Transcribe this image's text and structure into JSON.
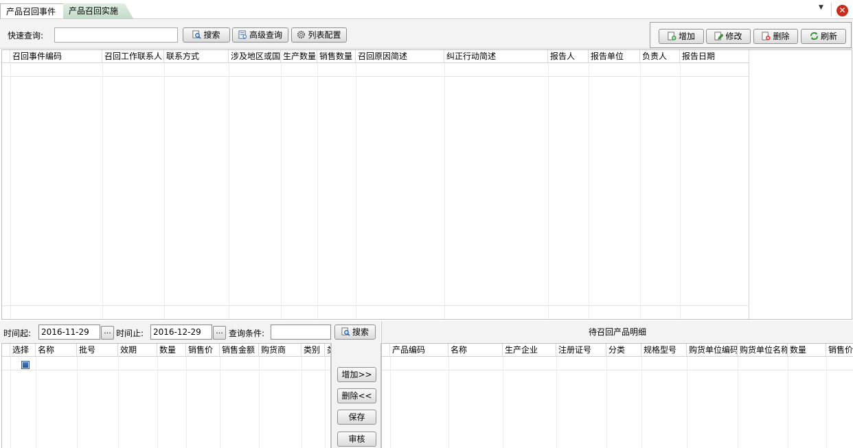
{
  "tabs": {
    "recall_event": "产品召回事件",
    "recall_impl": "产品召回实施"
  },
  "icons": {
    "dropdown": "▼",
    "close": "✕"
  },
  "toolbar": {
    "quick_query_label": "快速查询:",
    "quick_query_value": "",
    "search": "搜索",
    "advanced_query": "高级查询",
    "column_config": "列表配置",
    "add": "增加",
    "edit": "修改",
    "delete": "删除",
    "refresh": "刷新"
  },
  "main_grid": {
    "columns": [
      "召回事件编码",
      "召回工作联系人",
      "联系方式",
      "涉及地区或国",
      "生产数量",
      "销售数量",
      "召回原因简述",
      "纠正行动简述",
      "报告人",
      "报告单位",
      "负责人",
      "报告日期"
    ]
  },
  "filter": {
    "time_from_label": "时间起:",
    "time_from": "2016-11-29",
    "time_to_label": "时间止:",
    "time_to": "2016-12-29",
    "ellipsis": "...",
    "condition_label": "查询条件:",
    "condition_value": "",
    "search": "搜索"
  },
  "left_grid": {
    "columns": [
      "选择",
      "名称",
      "批号",
      "效期",
      "数量",
      "销售价",
      "销售金额",
      "购货商",
      "类别",
      "类"
    ]
  },
  "middle_buttons": {
    "add": "增加>>",
    "remove": "删除<<",
    "save": "保存",
    "audit": "审核"
  },
  "right_panel": {
    "title": "待召回产品明细",
    "columns": [
      "产品编码",
      "名称",
      "生产企业",
      "注册证号",
      "分类",
      "规格型号",
      "购货单位编码",
      "购货单位名称",
      "数量",
      "销售价"
    ]
  },
  "colors": {
    "tab_active_green": "#c3ddc8",
    "close_red": "#c62d1f",
    "checkbox_blue": "#1f4f94"
  }
}
